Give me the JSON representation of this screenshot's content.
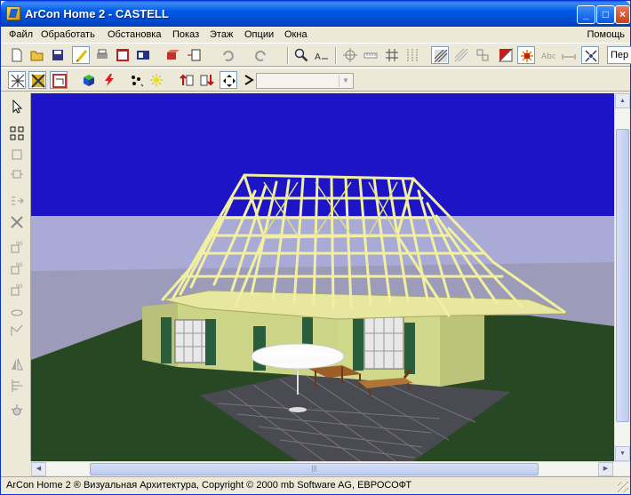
{
  "window": {
    "title": "ArCon  Home 2 - CASTELL",
    "controls": [
      "minimize",
      "maximize",
      "close"
    ]
  },
  "menu": {
    "items": [
      "Файл",
      "Обработать",
      "Обстановка",
      "Показ",
      "Этаж",
      "Опции",
      "Окна"
    ],
    "help": "Помощь"
  },
  "toolbar1": {
    "icons": [
      "new-icon",
      "open-icon",
      "save-icon",
      "pen-icon",
      "print-icon",
      "dialog-icon",
      "window-icon",
      "object-icon",
      "frame-icon",
      "undo-icon",
      "redo-icon",
      "zoom-icon",
      "measure-icon",
      "crosshair-icon",
      "ruler-icon",
      "grid-icon",
      "columns-icon",
      "hatch-fill-icon",
      "hatch-icon",
      "blocks-icon",
      "red-square-icon",
      "spark-icon",
      "text-style-icon",
      "dimension-icon",
      "pattern-icon"
    ],
    "view_combo_value": "Пер"
  },
  "toolbar2": {
    "icons": [
      "wire-view-icon",
      "solid-view-icon",
      "plan-view-icon",
      "cube-icon",
      "lightning-icon",
      "paint-icon",
      "sun-icon",
      "floor-up-icon",
      "floor-down-icon",
      "move-icon",
      "arrow-right-icon"
    ],
    "select_value": ""
  },
  "palette": {
    "icons": [
      "pointer-icon",
      "select-area-icon",
      "box-icon",
      "node-icon",
      "move-nodes-icon",
      "delete-icon",
      "rotate-90-icon",
      "rotate-90b-icon",
      "rotate-90c-icon",
      "rotate-free-icon",
      "dimension-icon",
      "mirror-icon",
      "align-icon",
      "light-icon"
    ]
  },
  "scene": {
    "colors": {
      "sky": "#1d14c8",
      "ground_far": "#aaaad6",
      "ground_near": "#9898b4",
      "lawn": "#284824",
      "wall": "#ccd488",
      "rafters": "#f0f0a0",
      "shutters": "#2a5d3c",
      "patio": "#4a4a52",
      "umbrella": "#fbfbfb",
      "furniture": "#9c5e28"
    }
  },
  "status": {
    "text": "ArCon Home 2 ® Визуальная Архитектура, Copyright © 2000 mb Software AG, ЕВРОСОФТ"
  }
}
